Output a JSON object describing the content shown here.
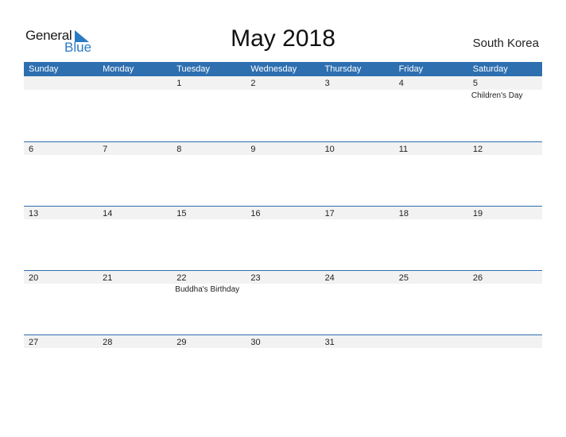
{
  "logo": {
    "word1": "General",
    "word2": "Blue",
    "icon": "blue-triangle-logo-icon"
  },
  "title": "May 2018",
  "country": "South Korea",
  "colors": {
    "accent": "#2e6fb0",
    "strip": "#f2f2f2",
    "logo_blue": "#2a7bc4"
  },
  "weekdays": [
    "Sunday",
    "Monday",
    "Tuesday",
    "Wednesday",
    "Thursday",
    "Friday",
    "Saturday"
  ],
  "weeks": [
    {
      "days": [
        {
          "n": "",
          "e": ""
        },
        {
          "n": "",
          "e": ""
        },
        {
          "n": "1",
          "e": ""
        },
        {
          "n": "2",
          "e": ""
        },
        {
          "n": "3",
          "e": ""
        },
        {
          "n": "4",
          "e": ""
        },
        {
          "n": "5",
          "e": "Children's Day"
        }
      ]
    },
    {
      "days": [
        {
          "n": "6",
          "e": ""
        },
        {
          "n": "7",
          "e": ""
        },
        {
          "n": "8",
          "e": ""
        },
        {
          "n": "9",
          "e": ""
        },
        {
          "n": "10",
          "e": ""
        },
        {
          "n": "11",
          "e": ""
        },
        {
          "n": "12",
          "e": ""
        }
      ]
    },
    {
      "days": [
        {
          "n": "13",
          "e": ""
        },
        {
          "n": "14",
          "e": ""
        },
        {
          "n": "15",
          "e": ""
        },
        {
          "n": "16",
          "e": ""
        },
        {
          "n": "17",
          "e": ""
        },
        {
          "n": "18",
          "e": ""
        },
        {
          "n": "19",
          "e": ""
        }
      ]
    },
    {
      "days": [
        {
          "n": "20",
          "e": ""
        },
        {
          "n": "21",
          "e": ""
        },
        {
          "n": "22",
          "e": "Buddha's Birthday"
        },
        {
          "n": "23",
          "e": ""
        },
        {
          "n": "24",
          "e": ""
        },
        {
          "n": "25",
          "e": ""
        },
        {
          "n": "26",
          "e": ""
        }
      ]
    },
    {
      "days": [
        {
          "n": "27",
          "e": ""
        },
        {
          "n": "28",
          "e": ""
        },
        {
          "n": "29",
          "e": ""
        },
        {
          "n": "30",
          "e": ""
        },
        {
          "n": "31",
          "e": ""
        },
        {
          "n": "",
          "e": ""
        },
        {
          "n": "",
          "e": ""
        }
      ]
    }
  ]
}
